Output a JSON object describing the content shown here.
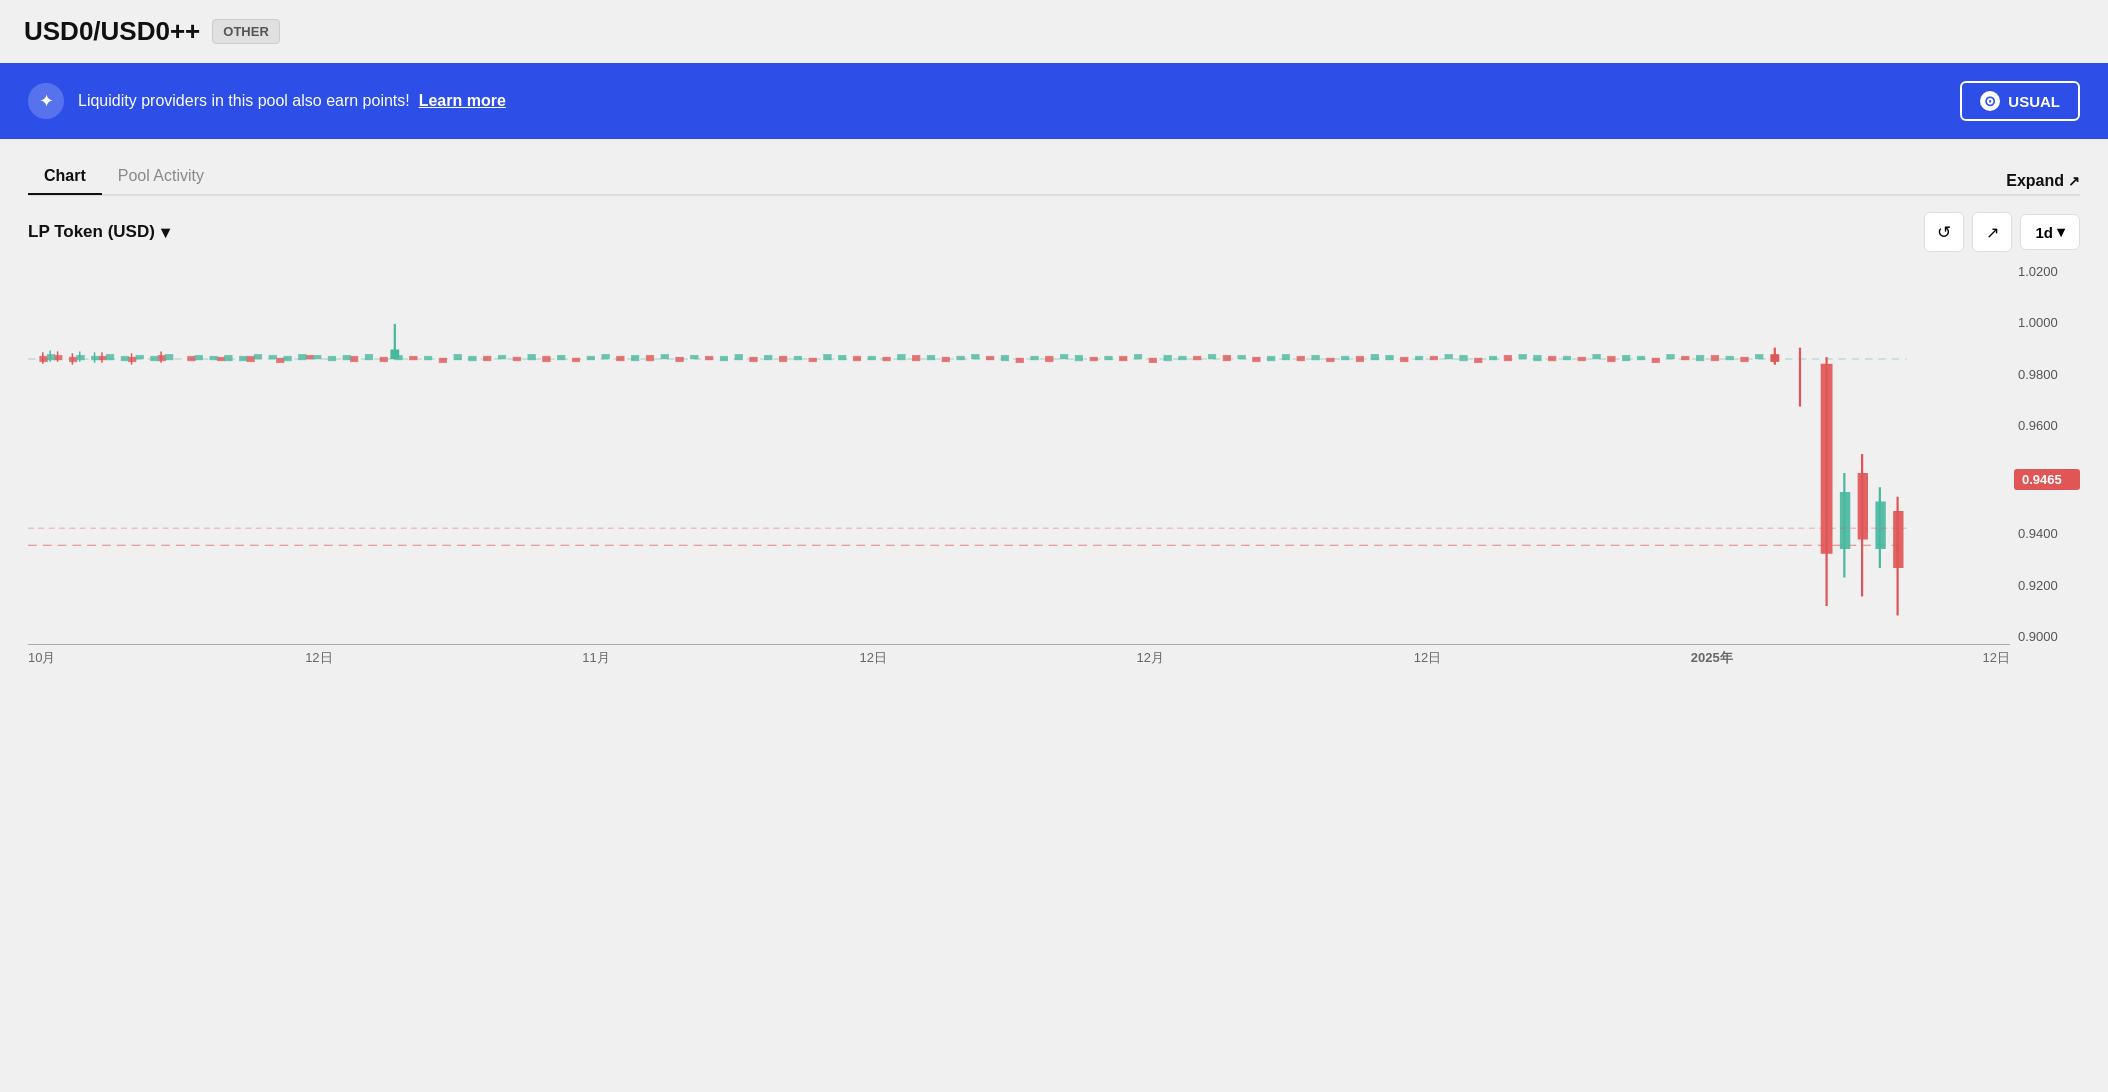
{
  "header": {
    "pair": "USD0/USD0++",
    "badge": "OTHER"
  },
  "banner": {
    "text": "Liquidity providers in this pool also earn points!",
    "link_text": "Learn more",
    "button_label": "USUAL"
  },
  "tabs": [
    {
      "label": "Chart",
      "active": true
    },
    {
      "label": "Pool Activity",
      "active": false
    }
  ],
  "chart": {
    "lp_token_label": "LP Token (USD)",
    "expand_label": "Expand",
    "timeframe": "1d",
    "price_label": "0.9465",
    "y_axis": [
      "1.0200",
      "1.0000",
      "0.9800",
      "0.9600",
      "0.9400",
      "0.9200",
      "0.9000"
    ],
    "x_axis": [
      "10月",
      "12日",
      "11月",
      "12日",
      "12月",
      "12日",
      "2025年",
      "12日"
    ]
  },
  "icons": {
    "refresh": "↺",
    "cursor": "↖",
    "expand_arrow": "↗",
    "dropdown": "▾",
    "star": "✦"
  }
}
